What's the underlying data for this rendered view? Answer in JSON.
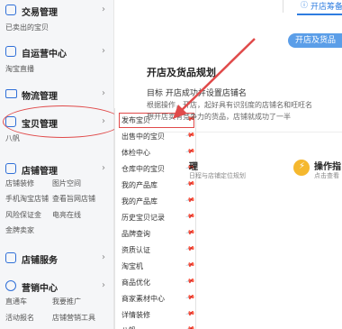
{
  "sidebar": {
    "sections": [
      {
        "title": "交易管理",
        "icon": "trade-icon",
        "subs": [
          "已卖出的宝贝"
        ]
      },
      {
        "title": "自运营中心",
        "icon": "operation-icon",
        "subs": [
          "淘宝直播"
        ]
      },
      {
        "title": "物流管理",
        "icon": "truck-icon",
        "subs": []
      },
      {
        "title": "宝贝管理",
        "icon": "goods-icon",
        "subs": [
          "八帆"
        ]
      },
      {
        "title": "店铺管理",
        "icon": "store-icon",
        "subs": [
          "店铺装修",
          "图片空间",
          "手机淘宝店铺",
          "查看旨网店铺",
          "风险保证金",
          "电亮在线",
          "金牌卖家"
        ]
      },
      {
        "title": "店铺服务",
        "icon": "service-icon",
        "subs": []
      },
      {
        "title": "营销中心",
        "icon": "marketing-icon",
        "subs": [
          "直通车",
          "我要推广",
          "活动报名",
          "店铺营销工具"
        ]
      }
    ],
    "chevron": "›"
  },
  "flyout": {
    "items": [
      "发布宝贝",
      "出售中的宝贝",
      "体检中心",
      "仓库中的宝贝",
      "我的产品库",
      "我的产品库",
      "历史宝贝记录",
      "品牌查询",
      "资质认证",
      "淘宝机",
      "商品优化",
      "商家素材中心",
      "详情装修",
      "八帆"
    ]
  },
  "main": {
    "tab_label": "开店筹备",
    "open_shop_button": "开店及货品",
    "card_title": "开店及货品规划",
    "card_target": "目标 开店成功并设置店铺名",
    "card_desc1": "根据操作，开店，起好具有识别度的店铺名和旺旺名",
    "card_desc2": "想开店卖有竞争力的货品，店铺就成功了一半",
    "sec2_title": "理",
    "sec2_sub": "日程与店铺定位规划",
    "op_title": "操作指",
    "op_sub": "点击查看"
  },
  "colors": {
    "accent": "#2f7de0",
    "annotation_red": "#e04a4a",
    "sidebar_bg": "#f5f6f8",
    "button_blue": "#5b9ee8",
    "op_icon": "#f5b82e"
  }
}
